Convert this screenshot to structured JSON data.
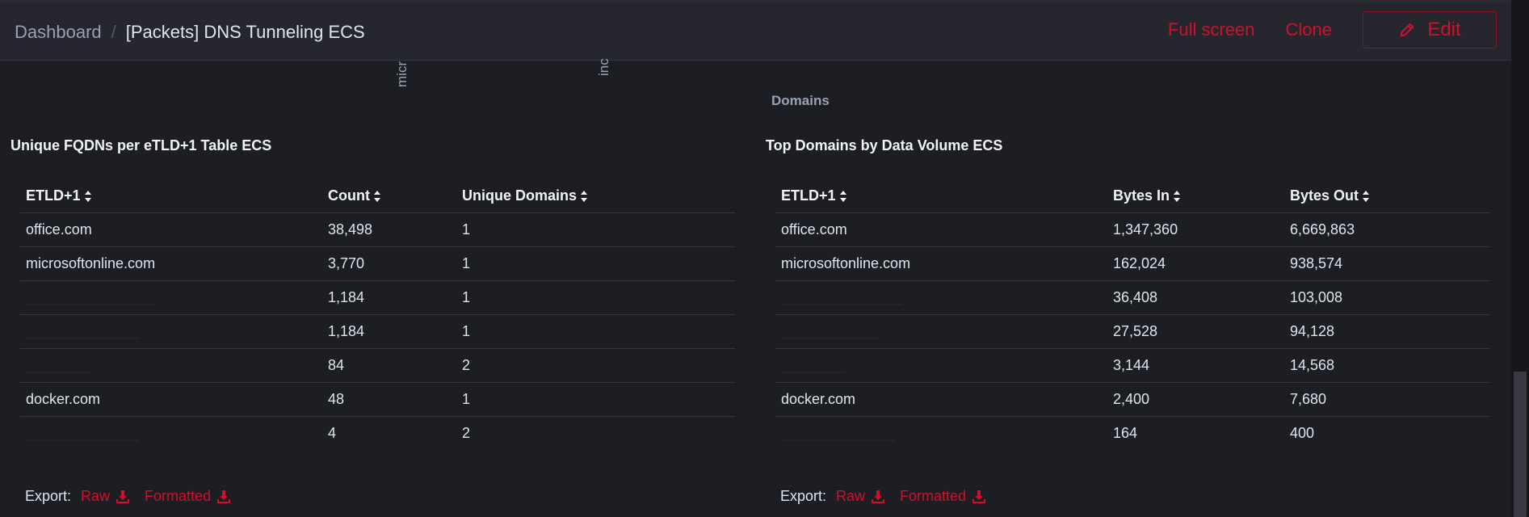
{
  "breadcrumb": {
    "root": "Dashboard",
    "separator": "/",
    "current": "[Packets] DNS Tunneling ECS"
  },
  "header": {
    "full_screen": "Full screen",
    "clone": "Clone",
    "edit": "Edit"
  },
  "chart_remnants": {
    "label_a": "micr",
    "label_b": "inc",
    "domains_axis": "Domains"
  },
  "left_panel": {
    "title": "Unique FQDNs per eTLD+1 Table ECS",
    "columns": [
      "ETLD+1",
      "Count",
      "Unique Domains"
    ],
    "rows": [
      [
        "office.com",
        "38,498",
        "1"
      ],
      [
        "microsoftonline.com",
        "3,770",
        "1"
      ],
      [
        "________________",
        "1,184",
        "1"
      ],
      [
        "______________",
        "1,184",
        "1"
      ],
      [
        "________",
        "84",
        "2"
      ],
      [
        "docker.com",
        "48",
        "1"
      ],
      [
        "______________",
        "4",
        "2"
      ]
    ],
    "export": {
      "label": "Export:",
      "raw": "Raw",
      "formatted": "Formatted"
    }
  },
  "right_panel": {
    "title": "Top Domains by Data Volume ECS",
    "columns": [
      "ETLD+1",
      "Bytes In",
      "Bytes Out"
    ],
    "rows": [
      [
        "office.com",
        "1,347,360",
        "6,669,863"
      ],
      [
        "microsoftonline.com",
        "162,024",
        "938,574"
      ],
      [
        "_______________",
        "36,408",
        "103,008"
      ],
      [
        "____________",
        "27,528",
        "94,128"
      ],
      [
        "________",
        "3,144",
        "14,568"
      ],
      [
        "docker.com",
        "2,400",
        "7,680"
      ],
      [
        "______________",
        "164",
        "400"
      ]
    ],
    "export": {
      "label": "Export:",
      "raw": "Raw",
      "formatted": "Formatted"
    }
  },
  "colors": {
    "accent": "#d0102a",
    "background": "#1d1e24",
    "header_bg": "#25262e",
    "text": "#dfe5ef",
    "muted": "#98a2b3"
  },
  "icons": [
    "pencil-icon",
    "sort-icon",
    "download-icon"
  ]
}
